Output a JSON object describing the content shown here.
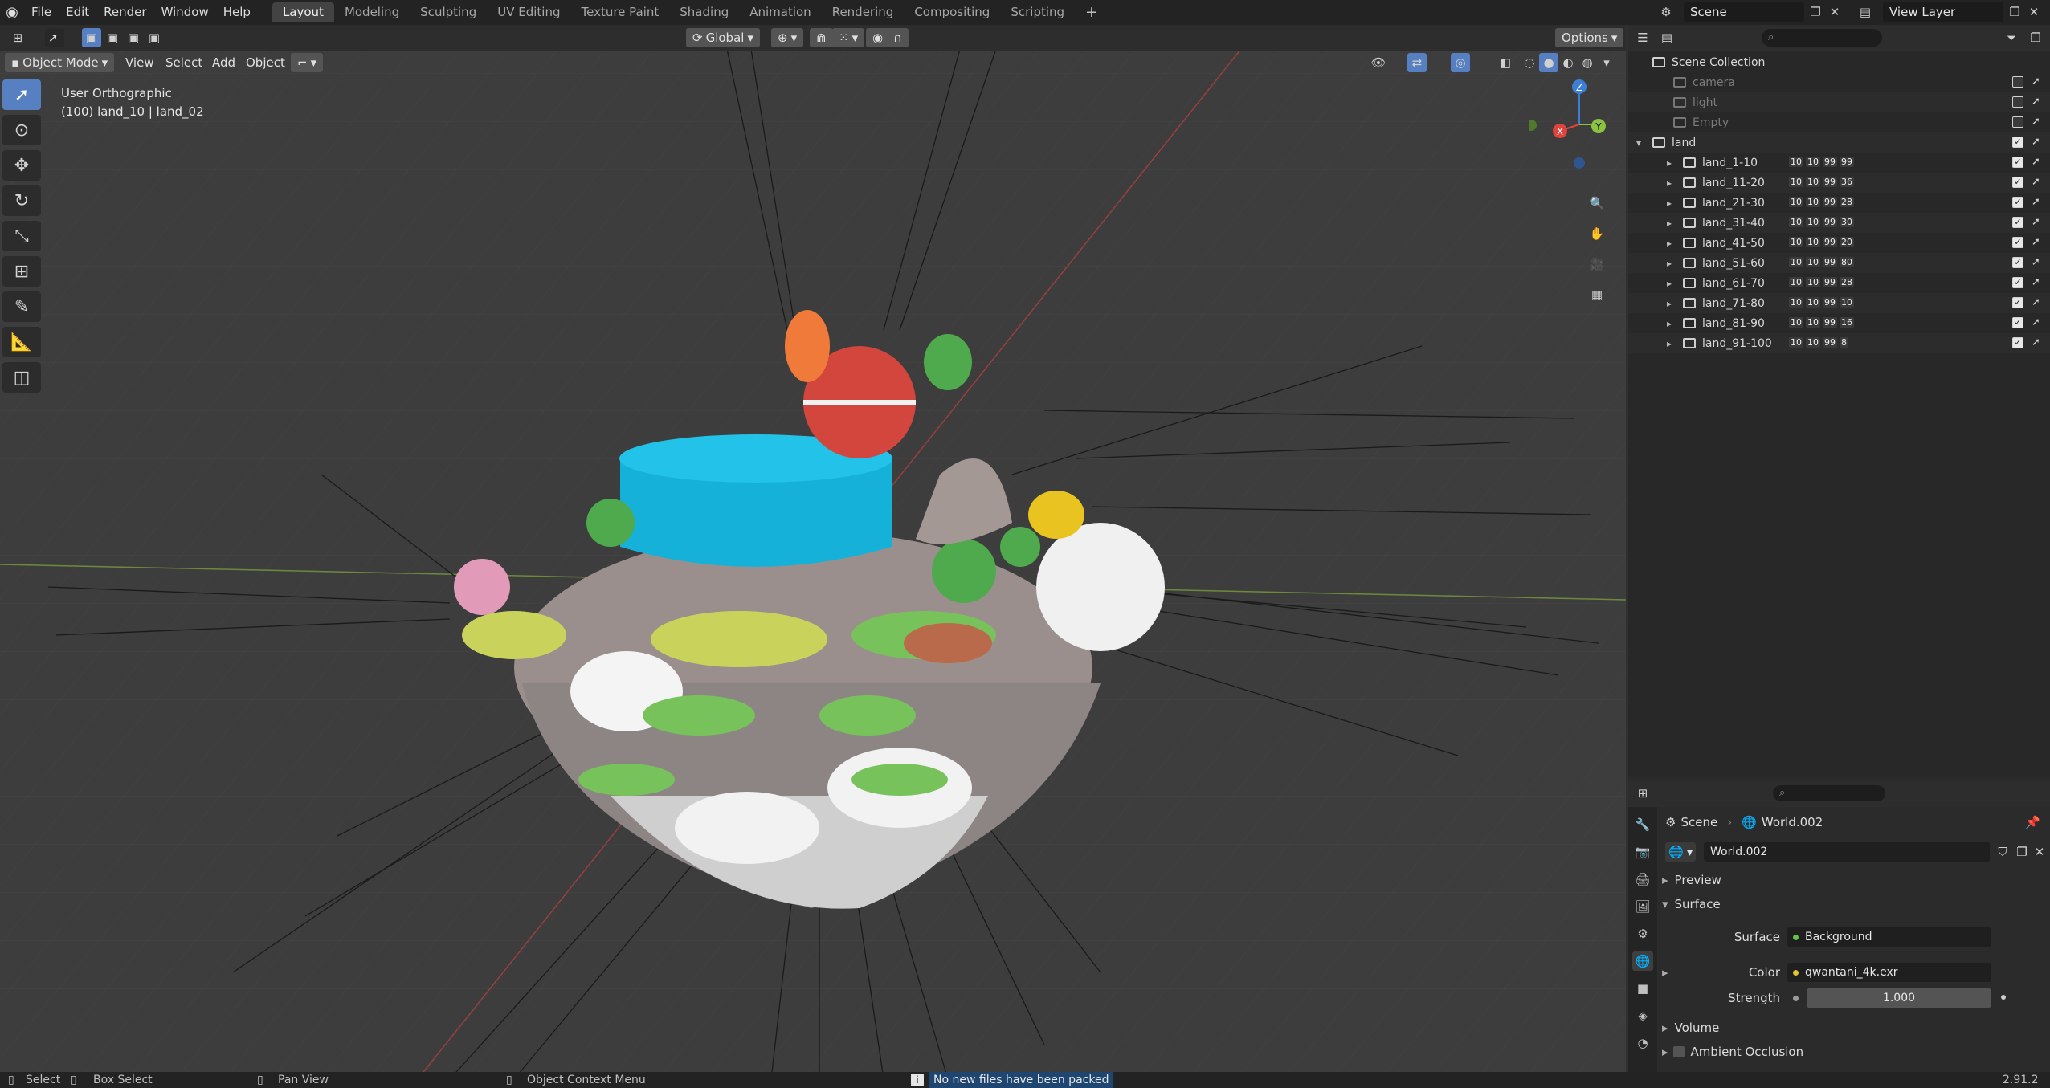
{
  "topbar": {
    "menus": [
      "File",
      "Edit",
      "Render",
      "Window",
      "Help"
    ],
    "tabs": [
      "Layout",
      "Modeling",
      "Sculpting",
      "UV Editing",
      "Texture Paint",
      "Shading",
      "Animation",
      "Rendering",
      "Compositing",
      "Scripting"
    ],
    "active_tab": "Layout",
    "scene": "Scene",
    "view_layer": "View Layer"
  },
  "viewport": {
    "transform_orientation": "Global",
    "options_label": "Options",
    "mode": "Object Mode",
    "menus": [
      "View",
      "Select",
      "Add",
      "Object"
    ],
    "view_name": "User Orthographic",
    "view_sub": "(100) land_10 | land_02",
    "gizmo": {
      "x": "X",
      "y": "Y",
      "z": "Z"
    }
  },
  "outliner": {
    "root": "Scene Collection",
    "items": [
      {
        "label": "camera",
        "dim": true,
        "checked": false
      },
      {
        "label": "light",
        "dim": true,
        "checked": false
      },
      {
        "label": "Empty",
        "dim": true,
        "checked": false
      },
      {
        "label": "land",
        "dim": false,
        "checked": true
      },
      {
        "label": "land_1-10",
        "dim": false,
        "checked": true,
        "chips": [
          "10",
          "10",
          "99",
          "99"
        ]
      },
      {
        "label": "land_11-20",
        "dim": false,
        "checked": true,
        "chips": [
          "10",
          "10",
          "99",
          "36"
        ]
      },
      {
        "label": "land_21-30",
        "dim": false,
        "checked": true,
        "chips": [
          "10",
          "10",
          "99",
          "28"
        ]
      },
      {
        "label": "land_31-40",
        "dim": false,
        "checked": true,
        "chips": [
          "10",
          "10",
          "99",
          "30"
        ]
      },
      {
        "label": "land_41-50",
        "dim": false,
        "checked": true,
        "chips": [
          "10",
          "10",
          "99",
          "20"
        ]
      },
      {
        "label": "land_51-60",
        "dim": false,
        "checked": true,
        "chips": [
          "10",
          "10",
          "99",
          "80"
        ]
      },
      {
        "label": "land_61-70",
        "dim": false,
        "checked": true,
        "chips": [
          "10",
          "10",
          "99",
          "28"
        ]
      },
      {
        "label": "land_71-80",
        "dim": false,
        "checked": true,
        "chips": [
          "10",
          "10",
          "99",
          "10"
        ]
      },
      {
        "label": "land_81-90",
        "dim": false,
        "checked": true,
        "chips": [
          "10",
          "10",
          "99",
          "16"
        ]
      },
      {
        "label": "land_91-100",
        "dim": false,
        "checked": true,
        "chips": [
          "10",
          "10",
          "99",
          "8"
        ]
      }
    ]
  },
  "properties": {
    "breadcrumb_scene": "Scene",
    "breadcrumb_world": "World.002",
    "world_name": "World.002",
    "panels": {
      "preview": "Preview",
      "surface": "Surface",
      "volume": "Volume",
      "ao": "Ambient Occlusion"
    },
    "surface_label": "Surface",
    "surface_value": "Background",
    "color_label": "Color",
    "color_value": "qwantani_4k.exr",
    "strength_label": "Strength",
    "strength_value": "1.000"
  },
  "statusbar": {
    "select": "Select",
    "box_select": "Box Select",
    "pan_view": "Pan View",
    "context_menu": "Object Context Menu",
    "message": "No new files have been packed",
    "version": "2.91.2"
  },
  "colors": {
    "accent": "#5680c2",
    "x_axis": "#e0423c",
    "y_axis": "#8bc341",
    "z_axis": "#3c7fd4"
  }
}
